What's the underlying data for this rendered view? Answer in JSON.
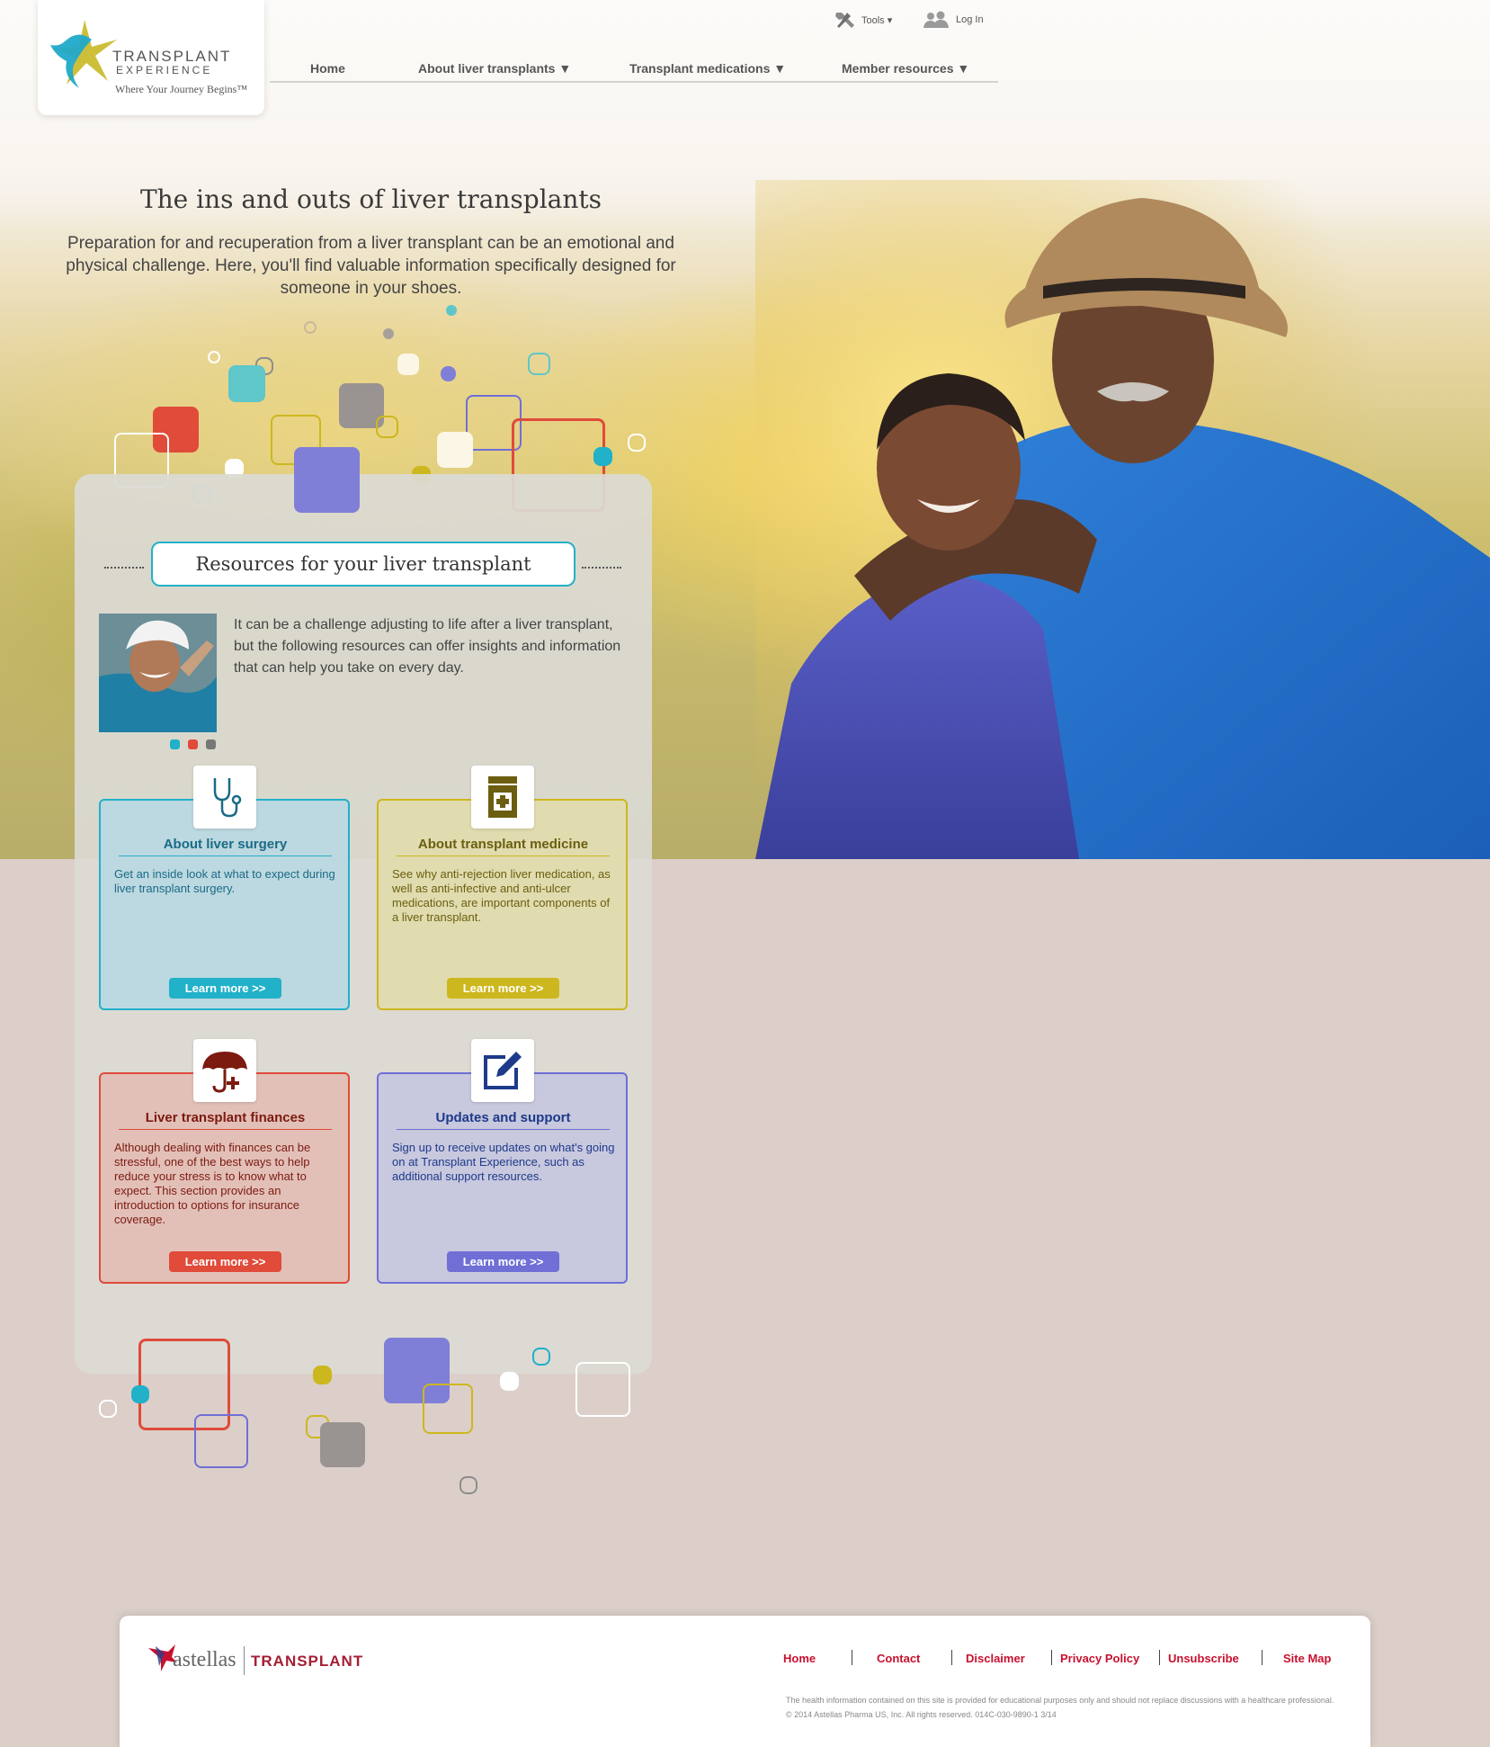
{
  "brand": {
    "name_line1": "TRANSPLANT",
    "name_line2": "EXPERIENCE",
    "tagline": "Where Your Journey Begins™"
  },
  "utility": {
    "tools_label": "Tools ▾",
    "login_label": "Log In"
  },
  "nav": [
    {
      "label": "Home"
    },
    {
      "label": "About liver transplants ▼"
    },
    {
      "label": "Transplant medications ▼"
    },
    {
      "label": "Member resources ▼"
    }
  ],
  "intro": {
    "title": "The ins and outs of liver transplants",
    "text": "Preparation for and recuperation from a liver transplant can be an emotional and physical challenge. Here, you'll find valuable information specifically designed for someone in your shoes."
  },
  "resources": {
    "title": "Resources for your liver transplant",
    "text": "It can be a challenge adjusting to life after a liver transplant, but the following resources can offer insights and information that can help you take on every day."
  },
  "cards": [
    {
      "title": "About liver surgery",
      "text": "Get an inside look at what to expect during liver transplant surgery.",
      "button": "Learn more >>",
      "icon": "stethoscope-icon",
      "color": "#21b1c9"
    },
    {
      "title": "About transplant medicine",
      "text": "See why anti-rejection liver medication, as well as anti-infective and anti-ulcer medications, are important components of a liver transplant.",
      "button": "Learn more >>",
      "icon": "medicine-bottle-icon",
      "color": "#cdb71e"
    },
    {
      "title": "Liver transplant finances",
      "text": "Although dealing with finances can be stressful, one of the best ways to help reduce your stress is to know what to expect. This section provides an introduction to options for insurance coverage.",
      "button": "Learn more >>",
      "icon": "umbrella-icon",
      "color": "#e04b3a"
    },
    {
      "title": "Updates and support",
      "text": "Sign up to receive updates on what's going on at Transplant Experience, such as additional support resources.",
      "button": "Learn more >>",
      "icon": "edit-icon",
      "color": "#6f6fd6"
    }
  ],
  "footer": {
    "company": "astellas",
    "division": "TRANSPLANT",
    "links": [
      "Home",
      "Contact",
      "Disclaimer",
      "Privacy Policy",
      "Unsubscribe",
      "Site Map"
    ],
    "disclaimer": "The health information contained on this site is provided for educational purposes only and should not replace discussions with a healthcare professional.",
    "copyright": "© 2014 Astellas Pharma US, Inc. All rights reserved. 014C-030-9890-1 3/14"
  }
}
